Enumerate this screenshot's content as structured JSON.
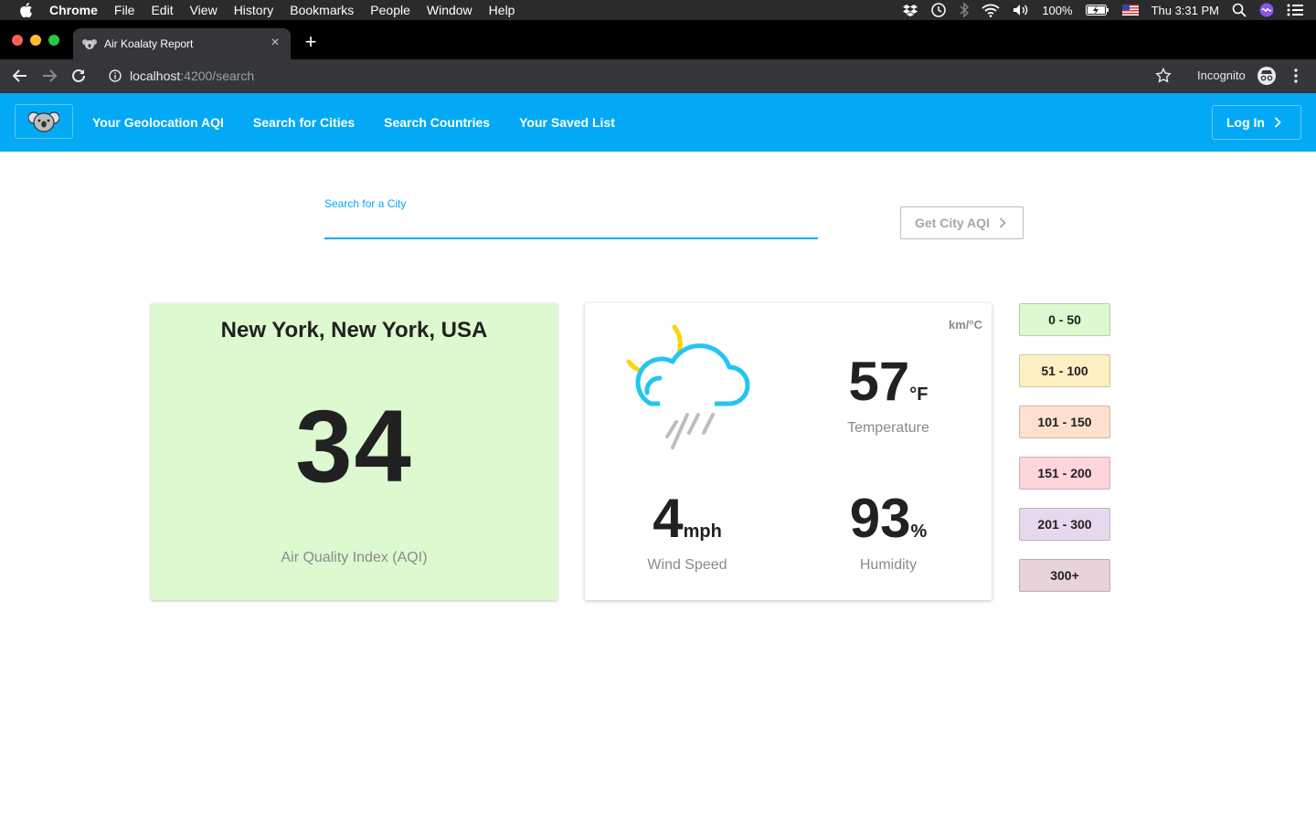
{
  "menubar": {
    "app": "Chrome",
    "menus": [
      "File",
      "Edit",
      "View",
      "History",
      "Bookmarks",
      "People",
      "Window",
      "Help"
    ],
    "battery": "100%",
    "clock": "Thu 3:31 PM"
  },
  "browser": {
    "tab_title": "Air Koalaty Report",
    "url_host": "localhost",
    "url_path": ":4200/search",
    "incognito_label": "Incognito"
  },
  "nav": {
    "links": [
      "Your Geolocation AQI",
      "Search for Cities",
      "Search Countries",
      "Your Saved List"
    ],
    "login_label": "Log In"
  },
  "search": {
    "label": "Search for a City",
    "value": "",
    "button_label": "Get City AQI"
  },
  "aqi_card": {
    "city": "New York, New York, USA",
    "value": "34",
    "label": "Air Quality Index (AQI)",
    "background": "#ddf9d0"
  },
  "weather": {
    "units_toggle": "km/°C",
    "icon": "night-rain-icon",
    "temperature": {
      "value": "57",
      "unit": "°F",
      "label": "Temperature"
    },
    "wind": {
      "value": "4",
      "unit": "mph",
      "label": "Wind Speed"
    },
    "humidity": {
      "value": "93",
      "unit": "%",
      "label": "Humidity"
    }
  },
  "legend": [
    {
      "range": "0 - 50",
      "color": "#ddf9d0"
    },
    {
      "range": "51 - 100",
      "color": "#fdf0c2"
    },
    {
      "range": "101 - 150",
      "color": "#fde0cd"
    },
    {
      "range": "151 - 200",
      "color": "#fdd5da"
    },
    {
      "range": "201 - 300",
      "color": "#e6d8ee"
    },
    {
      "range": "300+",
      "color": "#e8d3d9"
    }
  ],
  "colors": {
    "accent": "#03a9f4",
    "menubar": "#2b2a2d",
    "toolbar": "#35363a"
  }
}
